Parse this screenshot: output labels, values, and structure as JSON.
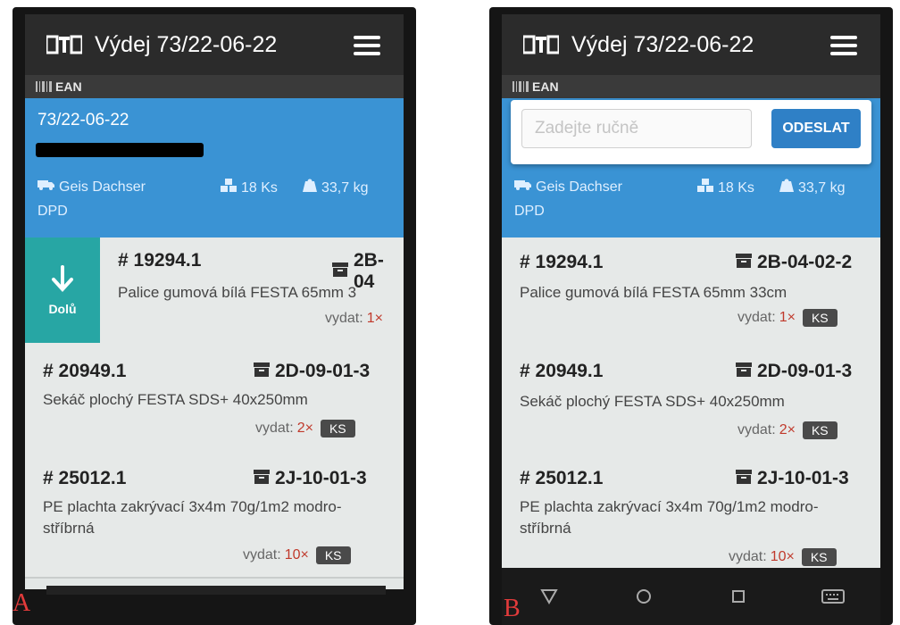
{
  "app": {
    "title": "Výdej 73/22-06-22",
    "subbar_label": "EAN"
  },
  "order": {
    "number": "73/22-06-22",
    "carrier": "Geis Dachser",
    "pieces": "18 Ks",
    "weight": "33,7 kg",
    "service": "DPD"
  },
  "panel_a": {
    "label": "A",
    "down_button": "Dolů",
    "items": [
      {
        "id": "# 19294.1",
        "location": "2B-04",
        "name": "Palice gumová bílá FESTA 65mm 3",
        "qty_label": "vydat:",
        "qty": "1×",
        "unit": ""
      },
      {
        "id": "# 20949.1",
        "location": "2D-09-01-3",
        "name": "Sekáč plochý FESTA SDS+ 40x250mm",
        "qty_label": "vydat:",
        "qty": "2×",
        "unit": "KS"
      },
      {
        "id": "# 25012.1",
        "location": "2J-10-01-3",
        "name": "PE plachta zakrývací 3x4m 70g/1m2 modro-stříbrná",
        "qty_label": "vydat:",
        "qty": "10×",
        "unit": "KS"
      }
    ]
  },
  "panel_b": {
    "label": "B",
    "manual_input_placeholder": "Zadejte ručně",
    "send_button": "ODESLAT",
    "items": [
      {
        "id": "# 19294.1",
        "location": "2B-04-02-2",
        "name": "Palice gumová bílá FESTA 65mm 33cm",
        "qty_label": "vydat:",
        "qty": "1×",
        "unit": "KS"
      },
      {
        "id": "# 20949.1",
        "location": "2D-09-01-3",
        "name": "Sekáč plochý FESTA SDS+ 40x250mm",
        "qty_label": "vydat:",
        "qty": "2×",
        "unit": "KS"
      },
      {
        "id": "# 25012.1",
        "location": "2J-10-01-3",
        "name": "PE plachta zakrývací 3x4m 70g/1m2 modro-stříbrná",
        "qty_label": "vydat:",
        "qty": "10×",
        "unit": "KS"
      }
    ]
  },
  "icons": {
    "logo": "cts-logo",
    "menu": "hamburger-menu-icon",
    "barcode": "barcode-icon",
    "truck": "truck-icon",
    "pieces": "boxes-icon",
    "weight": "scale-icon",
    "location": "archive-box-icon",
    "down": "arrow-down-icon",
    "nav_back": "nav-back-icon",
    "nav_home": "nav-home-icon",
    "nav_recent": "nav-recent-icon",
    "keyboard": "keyboard-icon"
  },
  "colors": {
    "appbar": "#2b2b2b",
    "info_blue": "#3a93d4",
    "down_teal": "#27a6a4",
    "send_blue": "#2f80c6",
    "qty_red": "#c0392b",
    "label_red": "#e23b3b"
  }
}
